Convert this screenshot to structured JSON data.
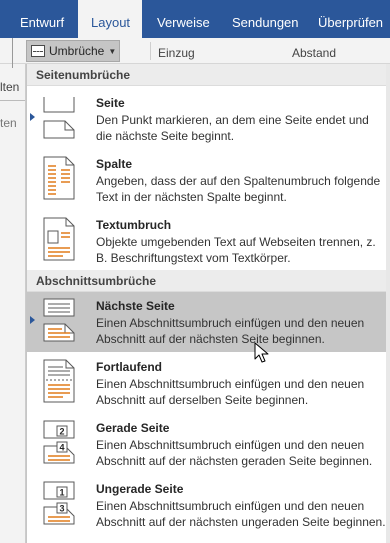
{
  "tabs": [
    {
      "label": "Entwurf",
      "active": false
    },
    {
      "label": "Layout",
      "active": true
    },
    {
      "label": "Verweise",
      "active": false
    },
    {
      "label": "Sendungen",
      "active": false
    },
    {
      "label": "Überprüfen",
      "active": false
    }
  ],
  "ribbon": {
    "breaks_label": "Umbrüche",
    "indent_label": "Einzug",
    "spacing_label": "Abstand",
    "left_fragment_1": "lten",
    "left_fragment_2": "ten"
  },
  "menu": {
    "section_page": "Seitenumbrüche",
    "section_section": "Abschnittsumbrüche",
    "items": [
      {
        "title": "Seite",
        "desc": "Den Punkt markieren, an dem eine Seite endet und die nächste Seite beginnt.",
        "icon": "page-break-icon"
      },
      {
        "title": "Spalte",
        "desc": "Angeben, dass der auf den Spaltenumbruch folgende Text in der nächsten Spalte beginnt.",
        "icon": "column-break-icon"
      },
      {
        "title": "Textumbruch",
        "desc": "Objekte umgebenden Text auf Webseiten trennen, z. B. Beschriftungstext vom Textkörper.",
        "icon": "text-wrapping-icon"
      },
      {
        "title": "Nächste Seite",
        "desc": "Einen Abschnittsumbruch einfügen und den neuen Abschnitt auf der nächsten Seite beginnen.",
        "icon": "next-page-icon"
      },
      {
        "title": "Fortlaufend",
        "desc": "Einen Abschnittsumbruch einfügen und den neuen Abschnitt auf derselben Seite beginnen.",
        "icon": "continuous-icon"
      },
      {
        "title": "Gerade Seite",
        "desc": "Einen Abschnittsumbruch einfügen und den neuen Abschnitt auf der nächsten geraden Seite beginnen.",
        "icon": "even-page-icon"
      },
      {
        "title": "Ungerade Seite",
        "desc": "Einen Abschnittsumbruch einfügen und den neuen Abschnitt auf der nächsten ungeraden Seite beginnen.",
        "icon": "odd-page-icon"
      }
    ]
  },
  "colors": {
    "tab_bar": "#2b579a",
    "hover": "#c6c6c6",
    "icon_accent": "#e07b1a"
  }
}
